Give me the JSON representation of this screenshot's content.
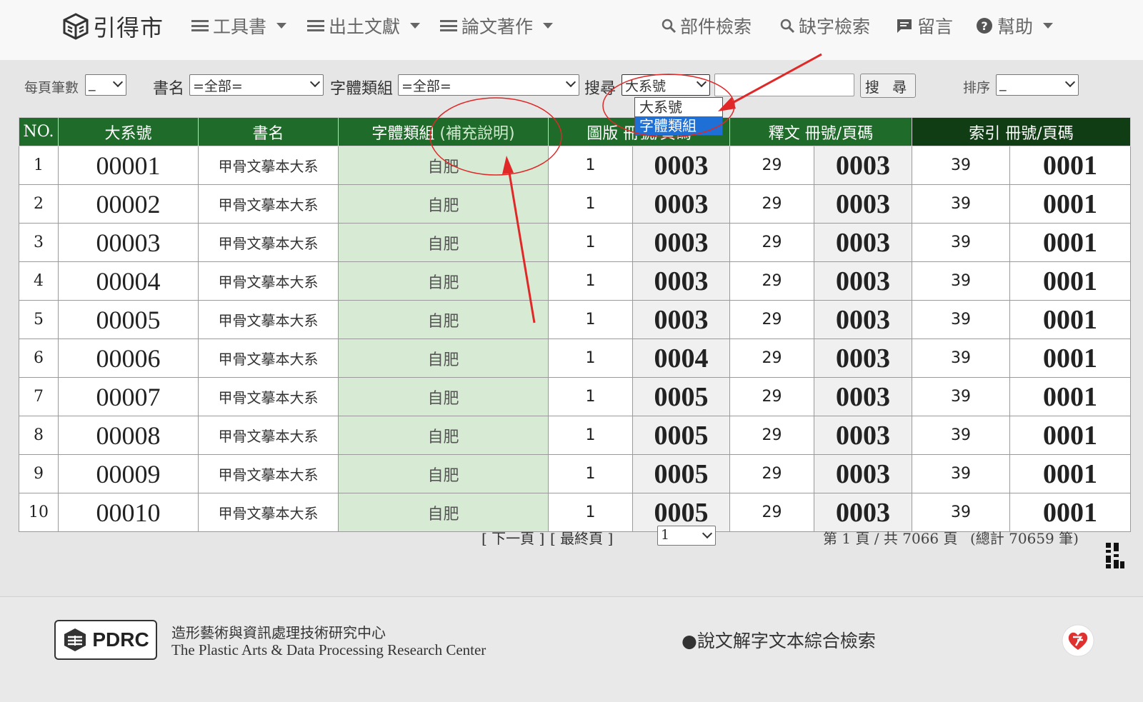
{
  "nav": {
    "logo_text": "引得市",
    "menus": [
      {
        "label": "工具書"
      },
      {
        "label": "出土文獻"
      },
      {
        "label": "論文著作"
      }
    ],
    "component_search": "部件檢索",
    "missing_char_search": "缺字檢索",
    "message": "留言",
    "help": "幫助"
  },
  "filters": {
    "per_page_label": "每頁筆數",
    "per_page_value": "_",
    "book_label": "書名",
    "book_value": "=全部=",
    "group_label": "字體類組",
    "group_value": "=全部=",
    "search_label": "搜尋",
    "search_field_value": "大系號",
    "search_field_options": [
      "大系號",
      "字體類組"
    ],
    "search_button": "搜 尋",
    "sort_label": "排序",
    "sort_value": "_"
  },
  "table": {
    "headers": {
      "no": "NO.",
      "id": "大系號",
      "book": "書名",
      "group": "字體類組",
      "group_sub": "(補充說明)",
      "plate": "圖版",
      "plate_hidden": "冊號/頁碼",
      "shiwen": "釋文 冊號/頁碼",
      "index": "索引 冊號/頁碼"
    },
    "rows": [
      {
        "no": "1",
        "id": "00001",
        "book": "甲骨文摹本大系",
        "group": "自肥",
        "plate_vol": "1",
        "plate_page": "0003",
        "sw_vol": "29",
        "sw_page": "0003",
        "idx_vol": "39",
        "idx_page": "0001"
      },
      {
        "no": "2",
        "id": "00002",
        "book": "甲骨文摹本大系",
        "group": "自肥",
        "plate_vol": "1",
        "plate_page": "0003",
        "sw_vol": "29",
        "sw_page": "0003",
        "idx_vol": "39",
        "idx_page": "0001"
      },
      {
        "no": "3",
        "id": "00003",
        "book": "甲骨文摹本大系",
        "group": "自肥",
        "plate_vol": "1",
        "plate_page": "0003",
        "sw_vol": "29",
        "sw_page": "0003",
        "idx_vol": "39",
        "idx_page": "0001"
      },
      {
        "no": "4",
        "id": "00004",
        "book": "甲骨文摹本大系",
        "group": "自肥",
        "plate_vol": "1",
        "plate_page": "0003",
        "sw_vol": "29",
        "sw_page": "0003",
        "idx_vol": "39",
        "idx_page": "0001"
      },
      {
        "no": "5",
        "id": "00005",
        "book": "甲骨文摹本大系",
        "group": "自肥",
        "plate_vol": "1",
        "plate_page": "0003",
        "sw_vol": "29",
        "sw_page": "0003",
        "idx_vol": "39",
        "idx_page": "0001"
      },
      {
        "no": "6",
        "id": "00006",
        "book": "甲骨文摹本大系",
        "group": "自肥",
        "plate_vol": "1",
        "plate_page": "0004",
        "sw_vol": "29",
        "sw_page": "0003",
        "idx_vol": "39",
        "idx_page": "0001"
      },
      {
        "no": "7",
        "id": "00007",
        "book": "甲骨文摹本大系",
        "group": "自肥",
        "plate_vol": "1",
        "plate_page": "0005",
        "sw_vol": "29",
        "sw_page": "0003",
        "idx_vol": "39",
        "idx_page": "0001"
      },
      {
        "no": "8",
        "id": "00008",
        "book": "甲骨文摹本大系",
        "group": "自肥",
        "plate_vol": "1",
        "plate_page": "0005",
        "sw_vol": "29",
        "sw_page": "0003",
        "idx_vol": "39",
        "idx_page": "0001"
      },
      {
        "no": "9",
        "id": "00009",
        "book": "甲骨文摹本大系",
        "group": "自肥",
        "plate_vol": "1",
        "plate_page": "0005",
        "sw_vol": "29",
        "sw_page": "0003",
        "idx_vol": "39",
        "idx_page": "0001"
      },
      {
        "no": "10",
        "id": "00010",
        "book": "甲骨文摹本大系",
        "group": "自肥",
        "plate_vol": "1",
        "plate_page": "0005",
        "sw_vol": "29",
        "sw_page": "0003",
        "idx_vol": "39",
        "idx_page": "0001"
      }
    ]
  },
  "pager": {
    "next": "[ 下一頁 ]",
    "last": "[ 最終頁 ]",
    "page_select": "1",
    "page_info": "第 1 頁 / 共 7066 頁",
    "total": "(總計 70659 筆)"
  },
  "footer": {
    "logo_text": "PDRC",
    "org_cn": "造形藝術與資訊處理技術研究中心",
    "org_en": "The Plastic Arts & Data Processing Research Center",
    "link": "●說文解字文本綜合檢索"
  },
  "colors": {
    "header_green": "#1f6b2a",
    "header_dark": "#103d14",
    "group_bg": "#d7ebd4",
    "annotation_red": "#e02828",
    "selected_option": "#1e6fd6"
  }
}
